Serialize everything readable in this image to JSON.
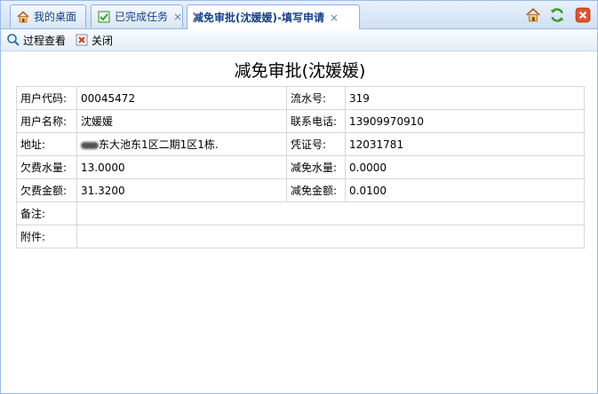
{
  "tabs": [
    {
      "label": "我的桌面",
      "icon": "home-icon"
    },
    {
      "label": "已完成任务",
      "icon": "task-list-icon",
      "close": "×"
    },
    {
      "label": "减免审批(沈媛媛)-填写申请",
      "icon": "",
      "close": "×",
      "active": true
    }
  ],
  "toolbar": {
    "process_view_label": "过程查看",
    "close_label": "关闭"
  },
  "form": {
    "title": "减免审批(沈媛媛)",
    "rows": {
      "user_code_label": "用户代码:",
      "user_code_value": "00045472",
      "serial_label": "流水号:",
      "serial_value": "319",
      "user_name_label": "用户名称:",
      "user_name_value": "沈媛媛",
      "phone_label": "联系电话:",
      "phone_value": "13909970910",
      "address_label": "地址:",
      "address_value": "东大池东1区二期1区1栋.",
      "voucher_label": "凭证号:",
      "voucher_value": "12031781",
      "owed_water_label": "欠费水量:",
      "owed_water_value": "13.0000",
      "reduced_water_label": "减免水量:",
      "reduced_water_value": "0.0000",
      "owed_amount_label": "欠费金额:",
      "owed_amount_value": "31.3200",
      "reduced_amount_label": "减免金额:",
      "reduced_amount_value": "0.0100",
      "remark_label": "备注:",
      "remark_value": "",
      "attachment_label": "附件:",
      "attachment_value": ""
    }
  },
  "colors": {
    "tab_text": "#15428b",
    "border": "#99bbe8",
    "cell_border": "#d6d6d6"
  }
}
